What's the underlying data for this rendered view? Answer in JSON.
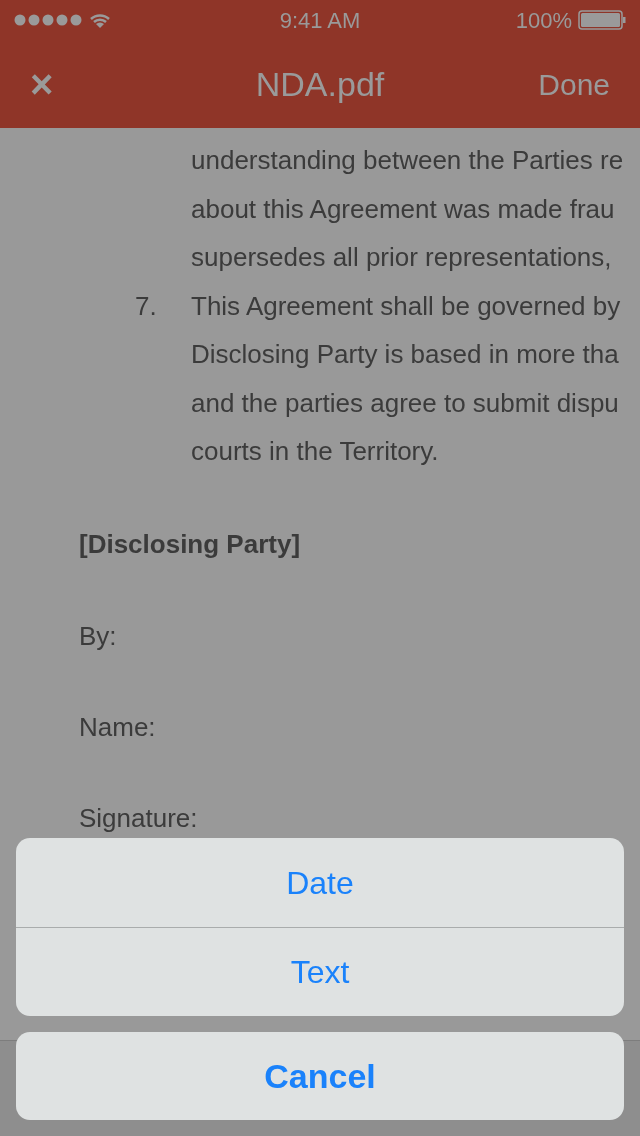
{
  "status_bar": {
    "time": "9:41 AM",
    "battery": "100%"
  },
  "nav_bar": {
    "close": "×",
    "title": "NDA.pdf",
    "done": "Done"
  },
  "document": {
    "lines": [
      {
        "text": "understanding between the Parties re"
      },
      {
        "text": "about this Agreement was made frau"
      },
      {
        "text": "supersedes all prior representations,"
      },
      {
        "number": "7.",
        "text": "This Agreement shall be governed by"
      },
      {
        "text": "Disclosing Party is based in more tha"
      },
      {
        "text": "and the parties agree to submit dispu"
      },
      {
        "text": "courts in the Territory."
      }
    ],
    "party": "[Disclosing Party]",
    "fields": [
      "By:",
      "Name:",
      "Signature:"
    ]
  },
  "action_sheet": {
    "options": [
      "Date",
      "Text"
    ],
    "cancel": "Cancel"
  }
}
